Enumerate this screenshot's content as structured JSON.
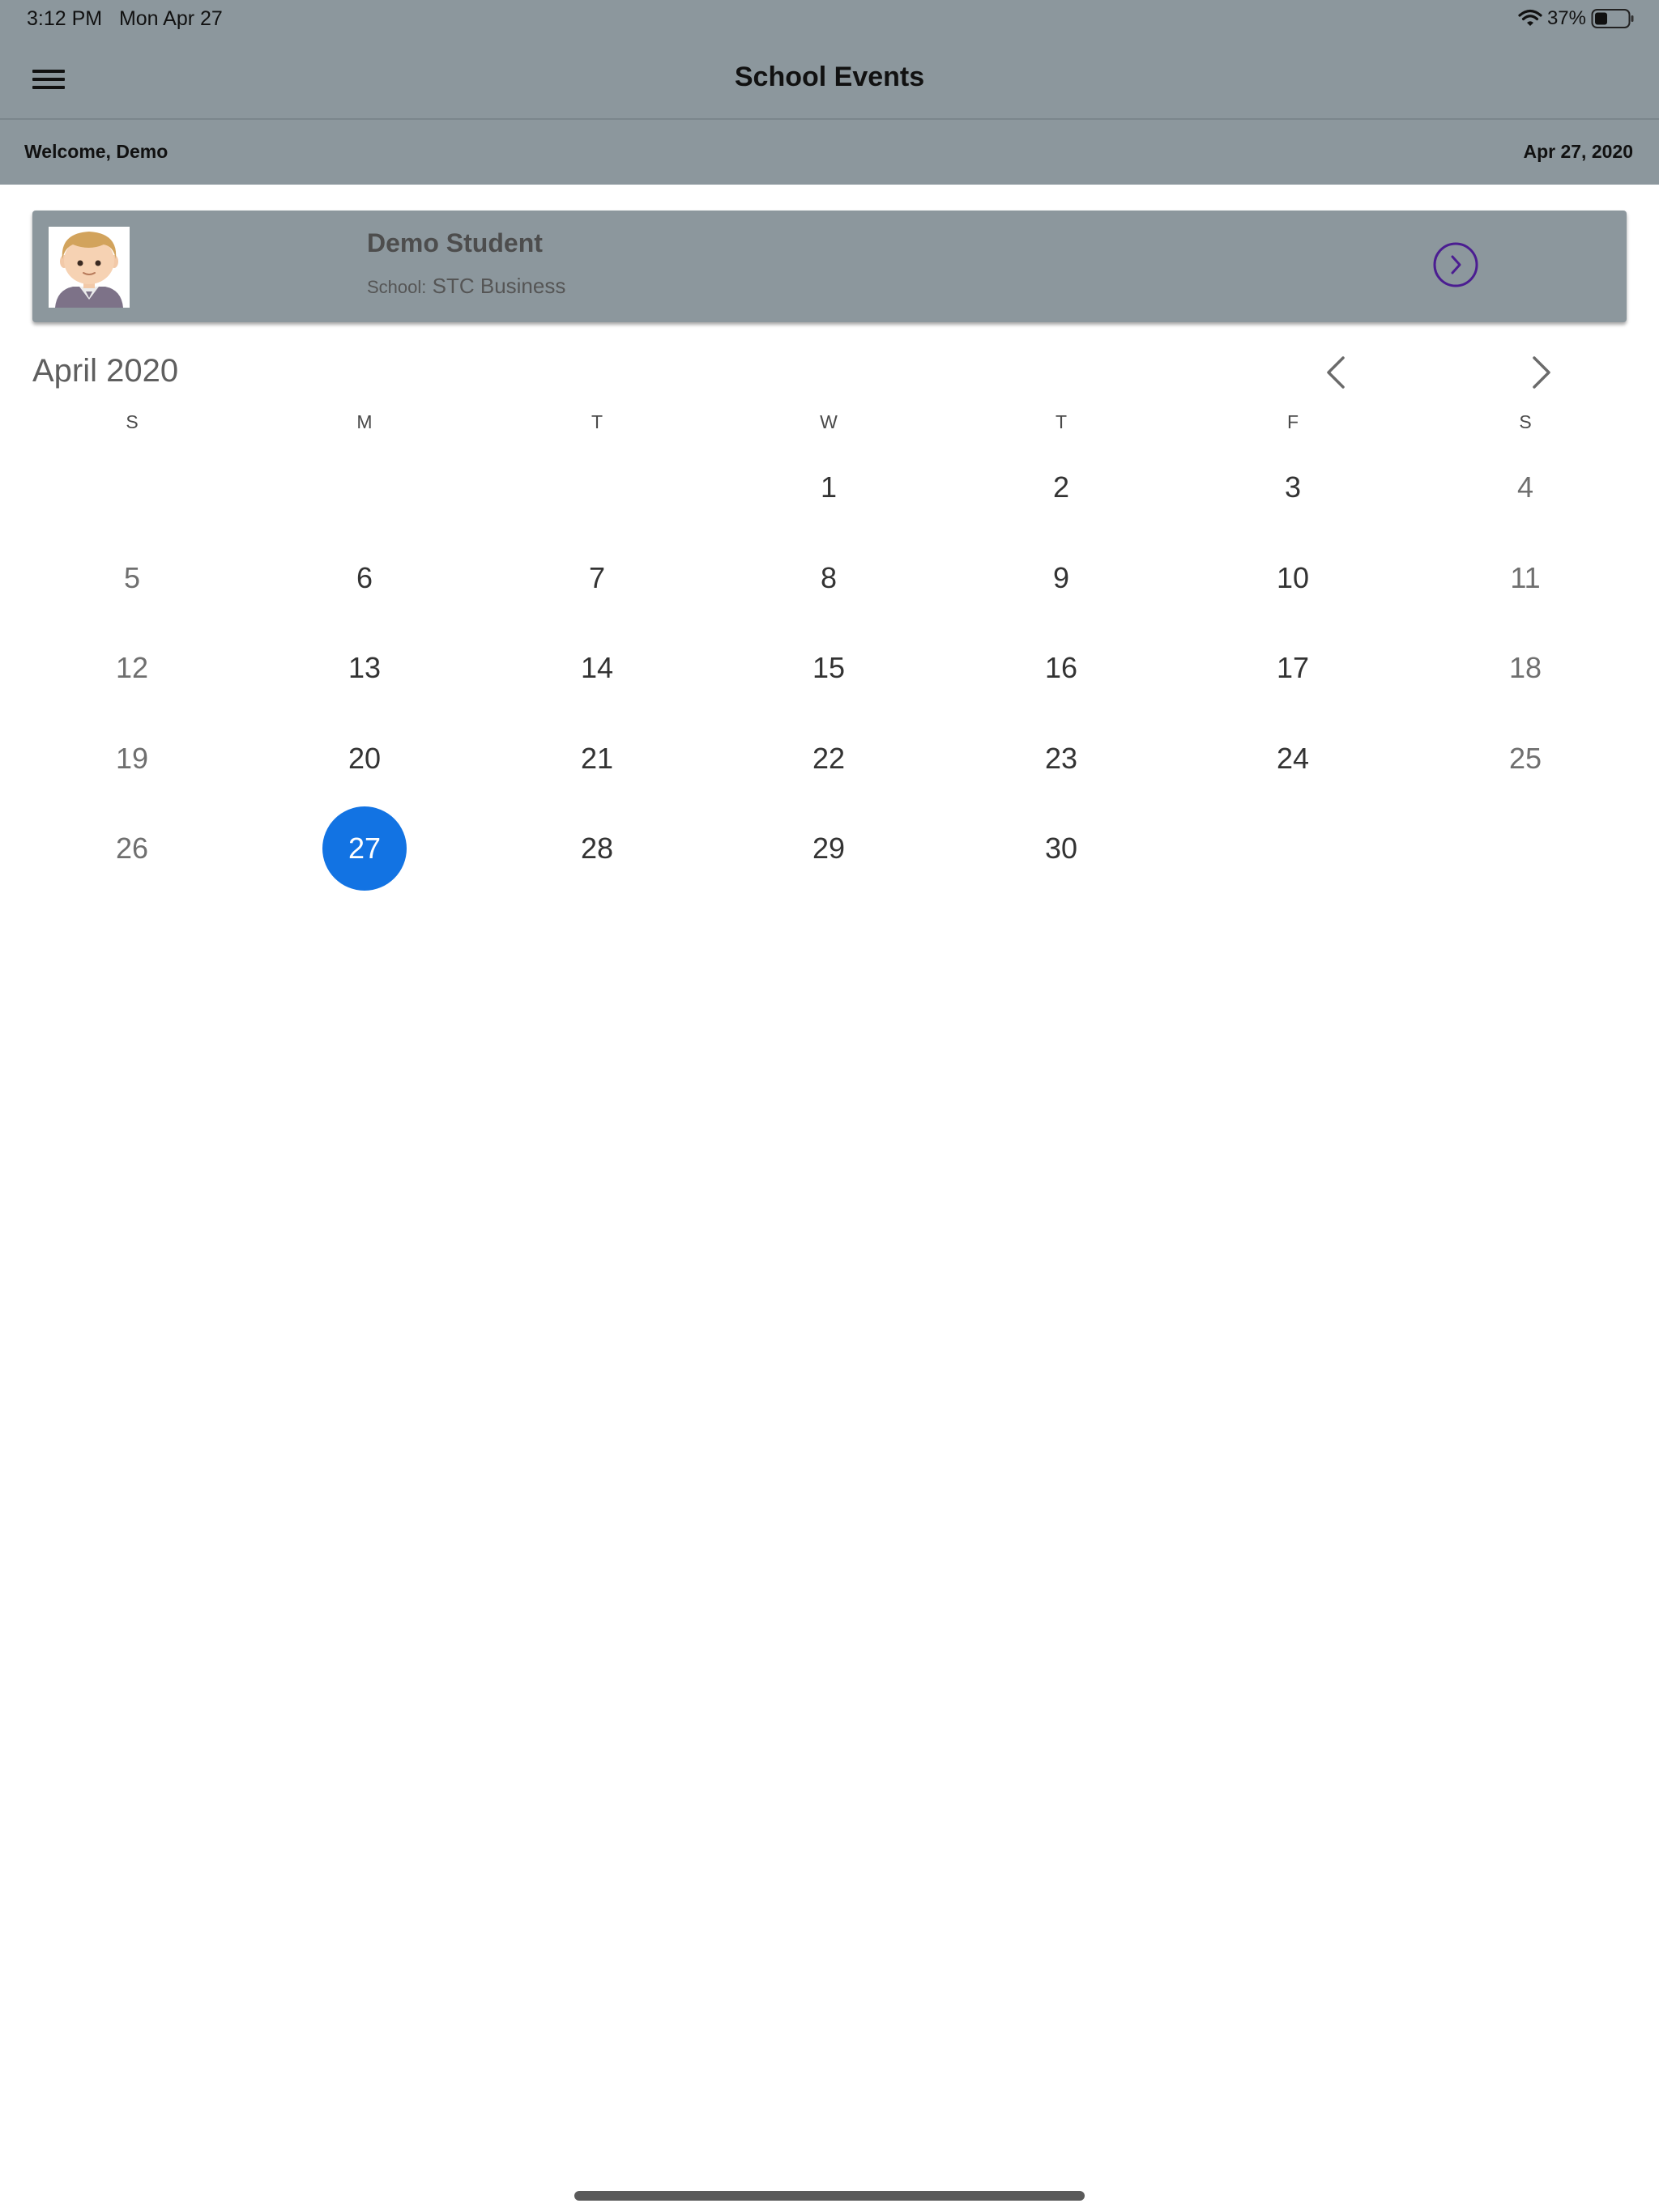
{
  "status_bar": {
    "time": "3:12 PM",
    "date": "Mon Apr 27",
    "battery": "37%"
  },
  "nav": {
    "title": "School Events"
  },
  "sub_bar": {
    "welcome": "Welcome, Demo",
    "date": "Apr 27, 2020"
  },
  "student": {
    "name": "Demo Student",
    "school_label": "School:",
    "school_name": "STC Business"
  },
  "calendar": {
    "month_title": "April 2020",
    "weekdays": [
      "S",
      "M",
      "T",
      "W",
      "T",
      "F",
      "S"
    ],
    "first_weekday_index": 3,
    "days_in_month": 30,
    "selected_day": 27
  },
  "colors": {
    "header_bg": "#8c979d",
    "selected": "#1273e3",
    "card_arrow": "#4b1d91"
  }
}
